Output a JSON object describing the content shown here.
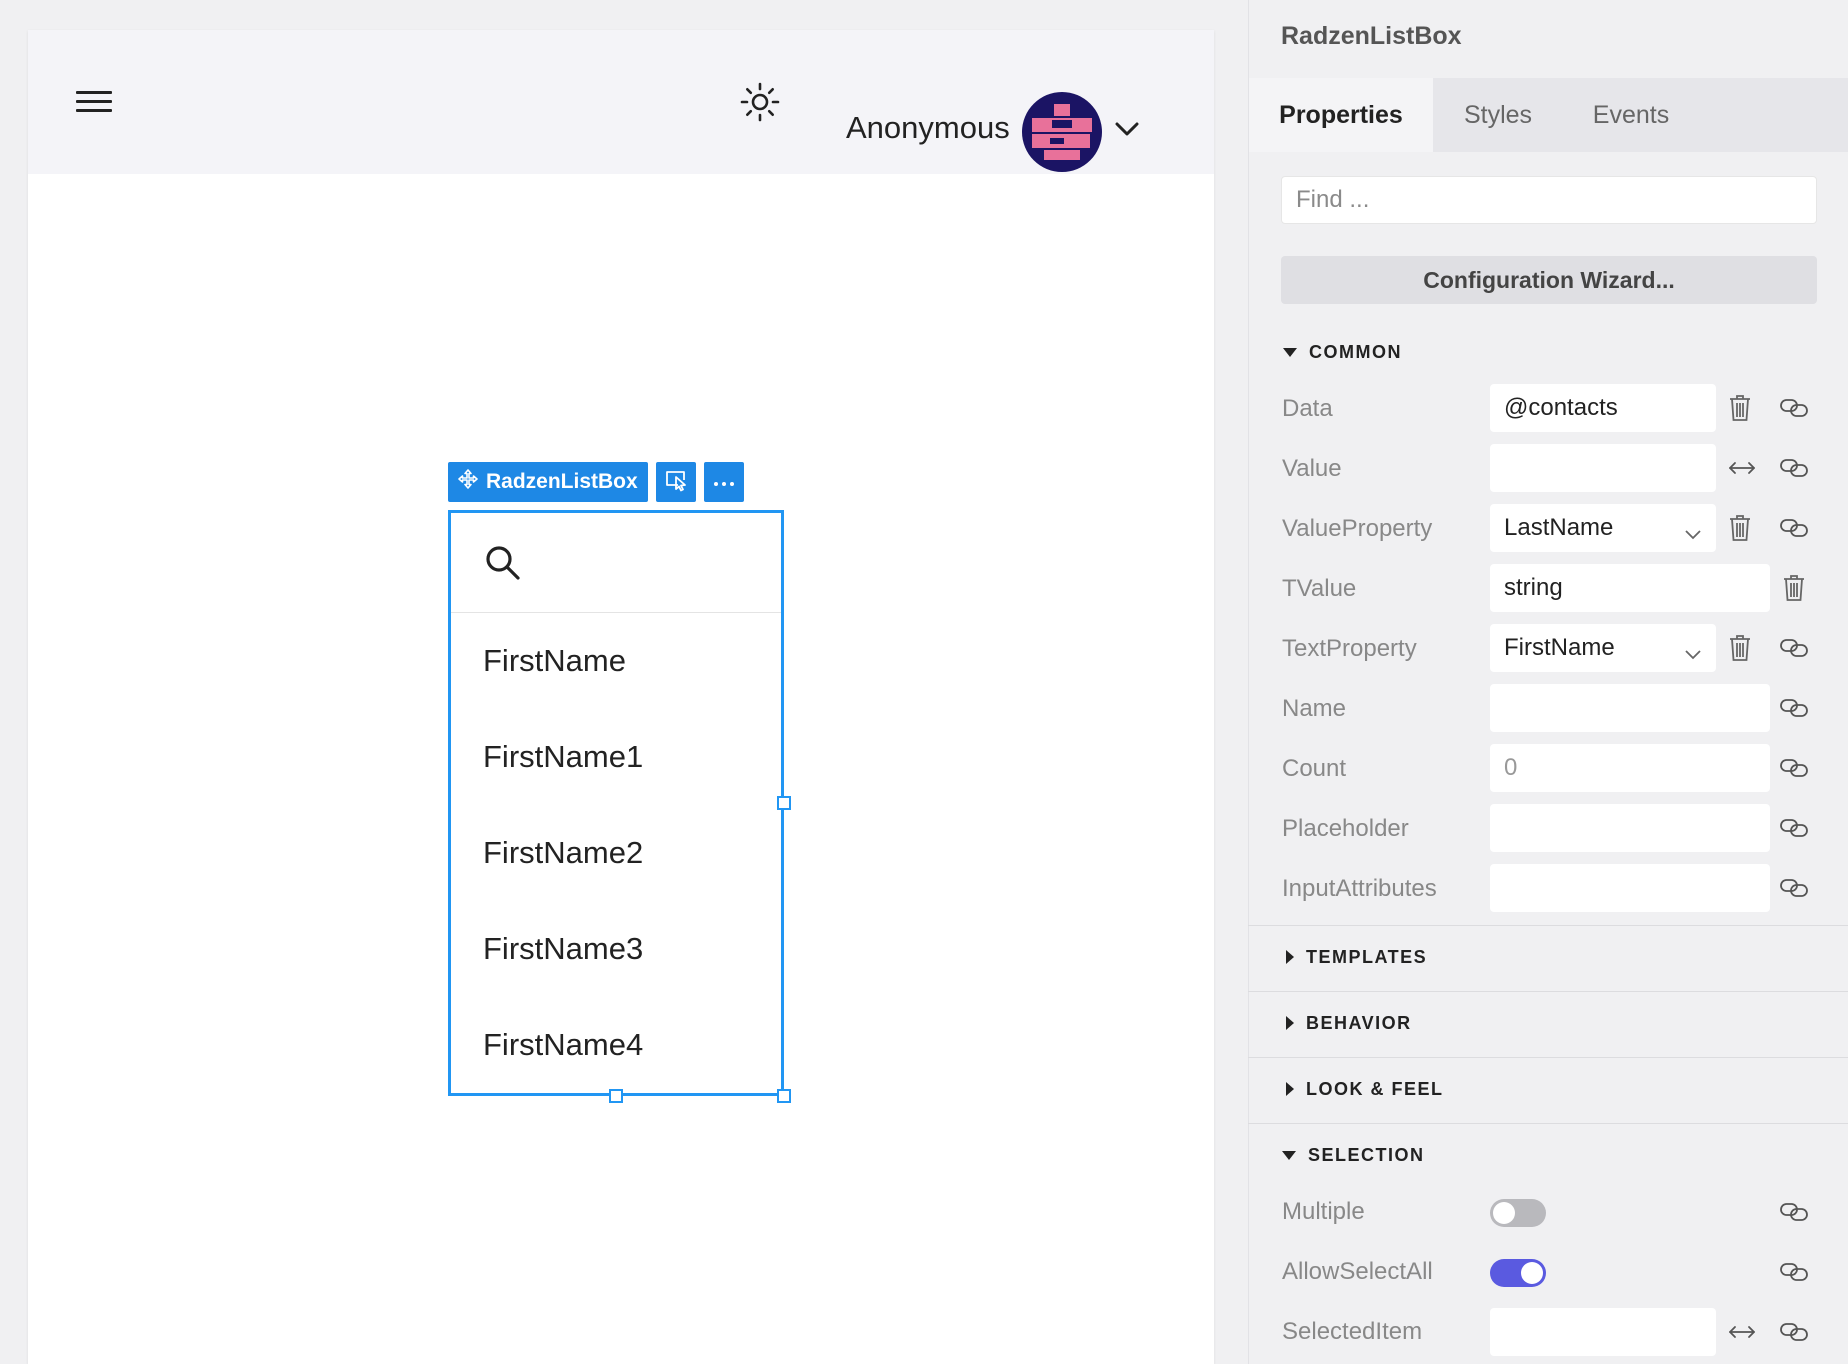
{
  "header": {
    "user_name": "Anonymous",
    "avatar_colors": {
      "background": "#1b1464",
      "pattern": "#e8719a"
    }
  },
  "component": {
    "tag_label": "RadzenListBox",
    "items": [
      "FirstName",
      "FirstName1",
      "FirstName2",
      "FirstName3",
      "FirstName4"
    ],
    "accent_color": "#1e88e5"
  },
  "panel": {
    "title": "RadzenListBox",
    "tabs": [
      {
        "label": "Properties",
        "active": true
      },
      {
        "label": "Styles",
        "active": false
      },
      {
        "label": "Events",
        "active": false
      }
    ],
    "find_placeholder": "Find ...",
    "wizard_label": "Configuration Wizard...",
    "sections": {
      "common": "COMMON",
      "templates": "TEMPLATES",
      "behavior": "BEHAVIOR",
      "look_feel": "LOOK & FEEL",
      "selection": "SELECTION"
    },
    "common_props": [
      {
        "label": "Data",
        "value": "@contacts"
      },
      {
        "label": "Value",
        "value": ""
      },
      {
        "label": "ValueProperty",
        "value": "LastName"
      },
      {
        "label": "TValue",
        "value": "string"
      },
      {
        "label": "TextProperty",
        "value": "FirstName"
      },
      {
        "label": "Name",
        "value": ""
      },
      {
        "label": "Count",
        "value": "0"
      },
      {
        "label": "Placeholder",
        "value": ""
      },
      {
        "label": "InputAttributes",
        "value": ""
      }
    ],
    "selection_props": [
      {
        "label": "Multiple",
        "toggle": false
      },
      {
        "label": "AllowSelectAll",
        "toggle": true
      },
      {
        "label": "SelectedItem",
        "value": ""
      }
    ]
  }
}
